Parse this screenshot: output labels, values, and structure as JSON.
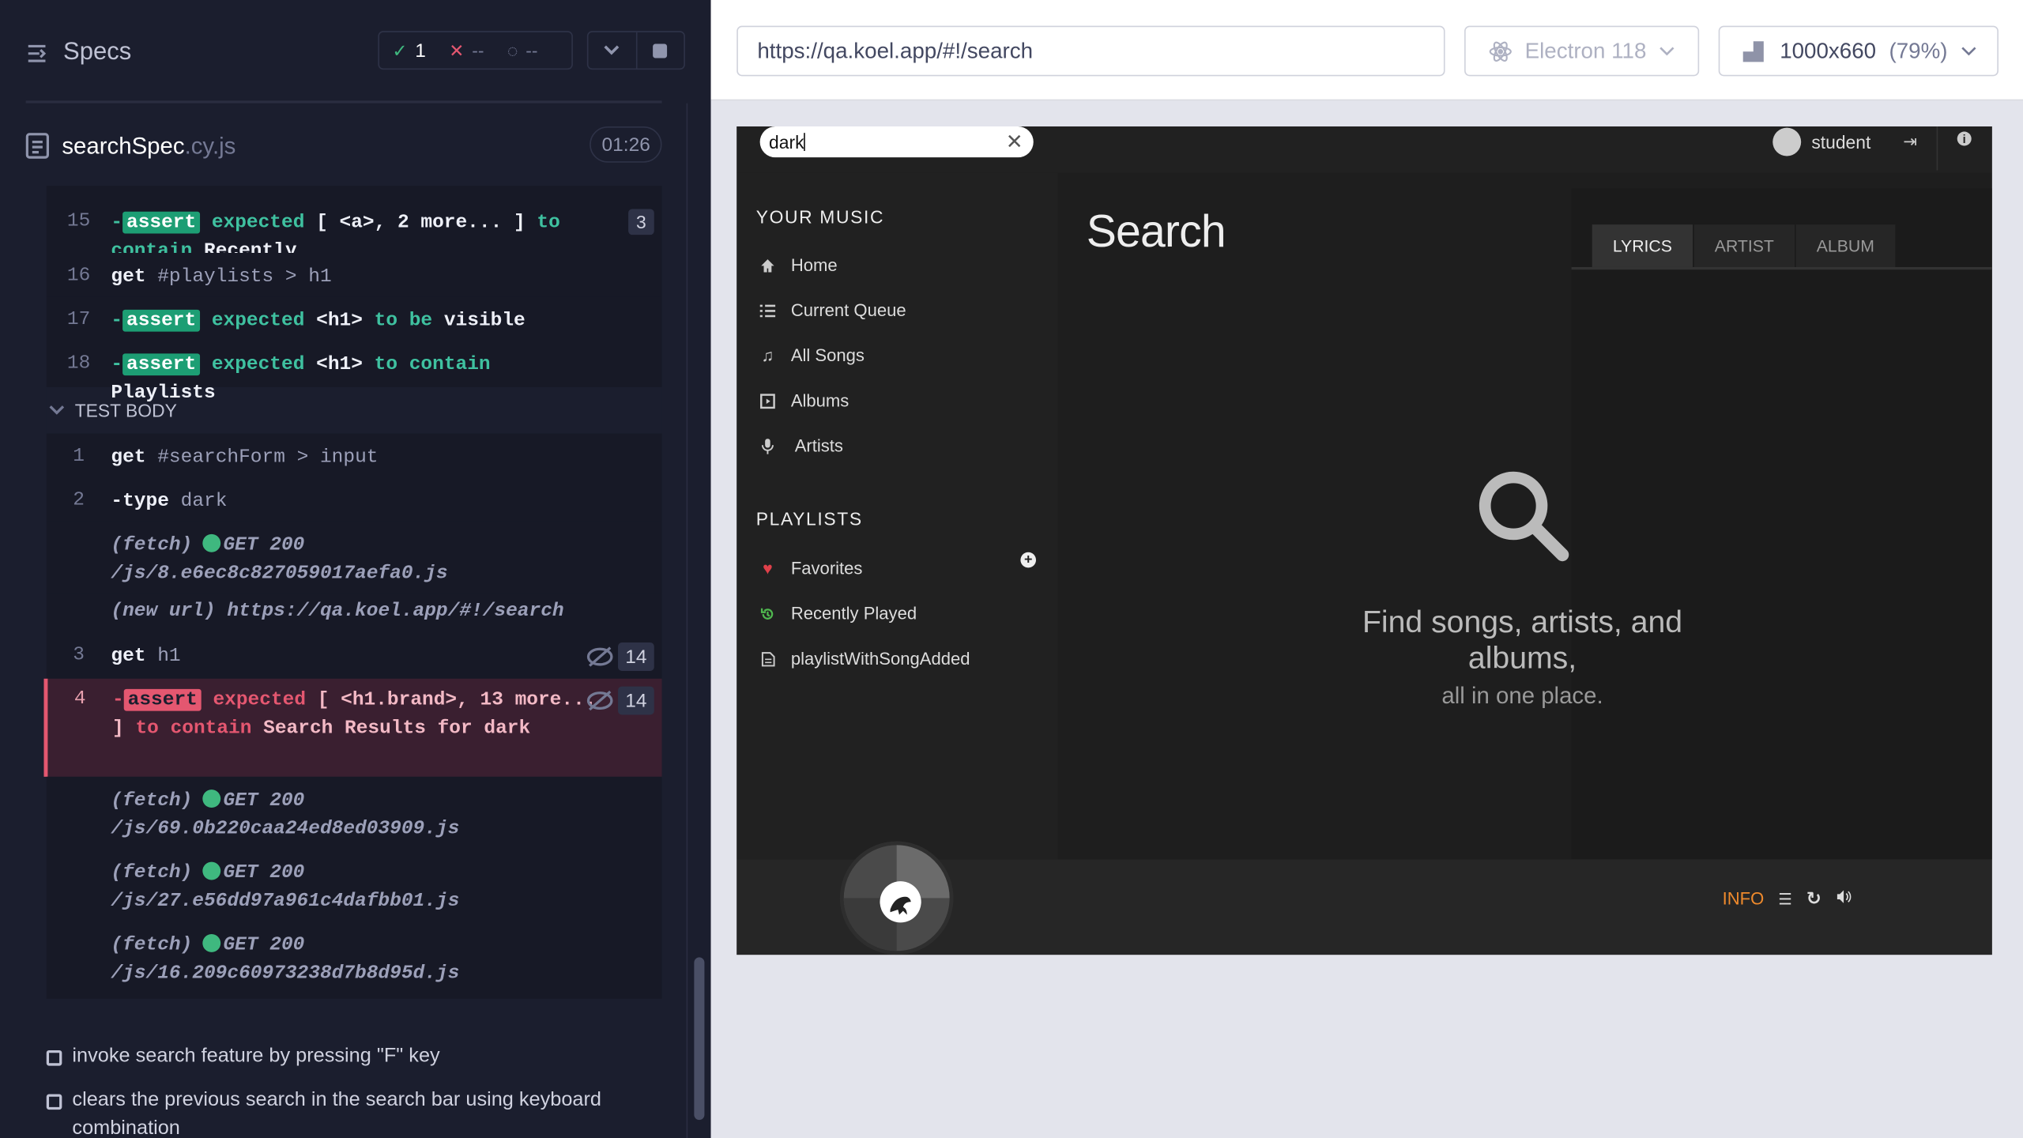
{
  "runner": {
    "specs_label": "Specs",
    "passed": "1",
    "failed": "--",
    "pending": "--",
    "spec_file": "searchSpec",
    "spec_ext": ".cy.js",
    "timer": "01:26",
    "test_body_label": "TEST BODY",
    "before_commands": [
      {
        "num": "15",
        "count": "3"
      },
      {
        "num": "16"
      },
      {
        "num": "17"
      },
      {
        "num": "18"
      }
    ],
    "cmd15": {
      "dash": "-",
      "badge": "assert",
      "t1": "expected",
      "t2": "[ <a>, 2 more... ]",
      "t3": "to",
      "t4": "contain",
      "t5": "Recently"
    },
    "cmd16": {
      "name": "get",
      "arg": "#playlists > h1"
    },
    "cmd17": {
      "dash": "-",
      "badge": "assert",
      "t1": "expected",
      "t2": "<h1>",
      "t3": "to be",
      "t4": "visible"
    },
    "cmd18": {
      "dash": "-",
      "badge": "assert",
      "t1": "expected",
      "t2": "<h1>",
      "t3": "to contain",
      "t4": "Playlists"
    },
    "body": {
      "c1": {
        "num": "1",
        "name": "get",
        "arg": "#searchForm > input"
      },
      "c2": {
        "num": "2",
        "name": "-type",
        "arg": "dark"
      },
      "f1": {
        "label": "(fetch)",
        "method": "GET 200",
        "path": "/js/8.e6ec8c827059017aefa0.js"
      },
      "nu": {
        "label": "(new url)",
        "url": "https://qa.koel.app/#!/search"
      },
      "c3": {
        "num": "3",
        "name": "get",
        "arg": "h1",
        "count": "14"
      },
      "c4": {
        "num": "4",
        "dash": "-",
        "badge": "assert",
        "t1": "expected",
        "t2": "[ <h1.brand>, 13 more... ]",
        "t3": "to contain",
        "t4": "Search Results for dark",
        "count": "14"
      },
      "f2": {
        "label": "(fetch)",
        "method": "GET 200",
        "path": "/js/69.0b220caa24ed8ed03909.js"
      },
      "f3": {
        "label": "(fetch)",
        "method": "GET 200",
        "path": "/js/27.e56dd97a961c4dafbb01.js"
      },
      "f4": {
        "label": "(fetch)",
        "method": "GET 200",
        "path": "/js/16.209c60973238d7b8d95d.js"
      }
    },
    "tests": [
      "invoke search feature by pressing \"F\" key",
      "clears the previous search in the search bar using keyboard combination"
    ]
  },
  "browser_bar": {
    "url": "https://qa.koel.app/#!/search",
    "browser": "Electron 118",
    "viewport": "1000x660",
    "zoom": "(79%)"
  },
  "app": {
    "search_value": "dark",
    "user": "student",
    "your_music": "YOUR MUSIC",
    "nav": [
      "Home",
      "Current Queue",
      "All Songs",
      "Albums",
      "Artists"
    ],
    "playlists_heading": "PLAYLISTS",
    "playlists": [
      "Favorites",
      "Recently Played",
      "playlistWithSongAdded"
    ],
    "title": "Search",
    "tabs": [
      "LYRICS",
      "ARTIST",
      "ALBUM"
    ],
    "empty_big": "Find songs, artists, and albums,",
    "empty_small": "all in one place.",
    "info_button": "INFO",
    "accent": "#ef8a2c"
  }
}
